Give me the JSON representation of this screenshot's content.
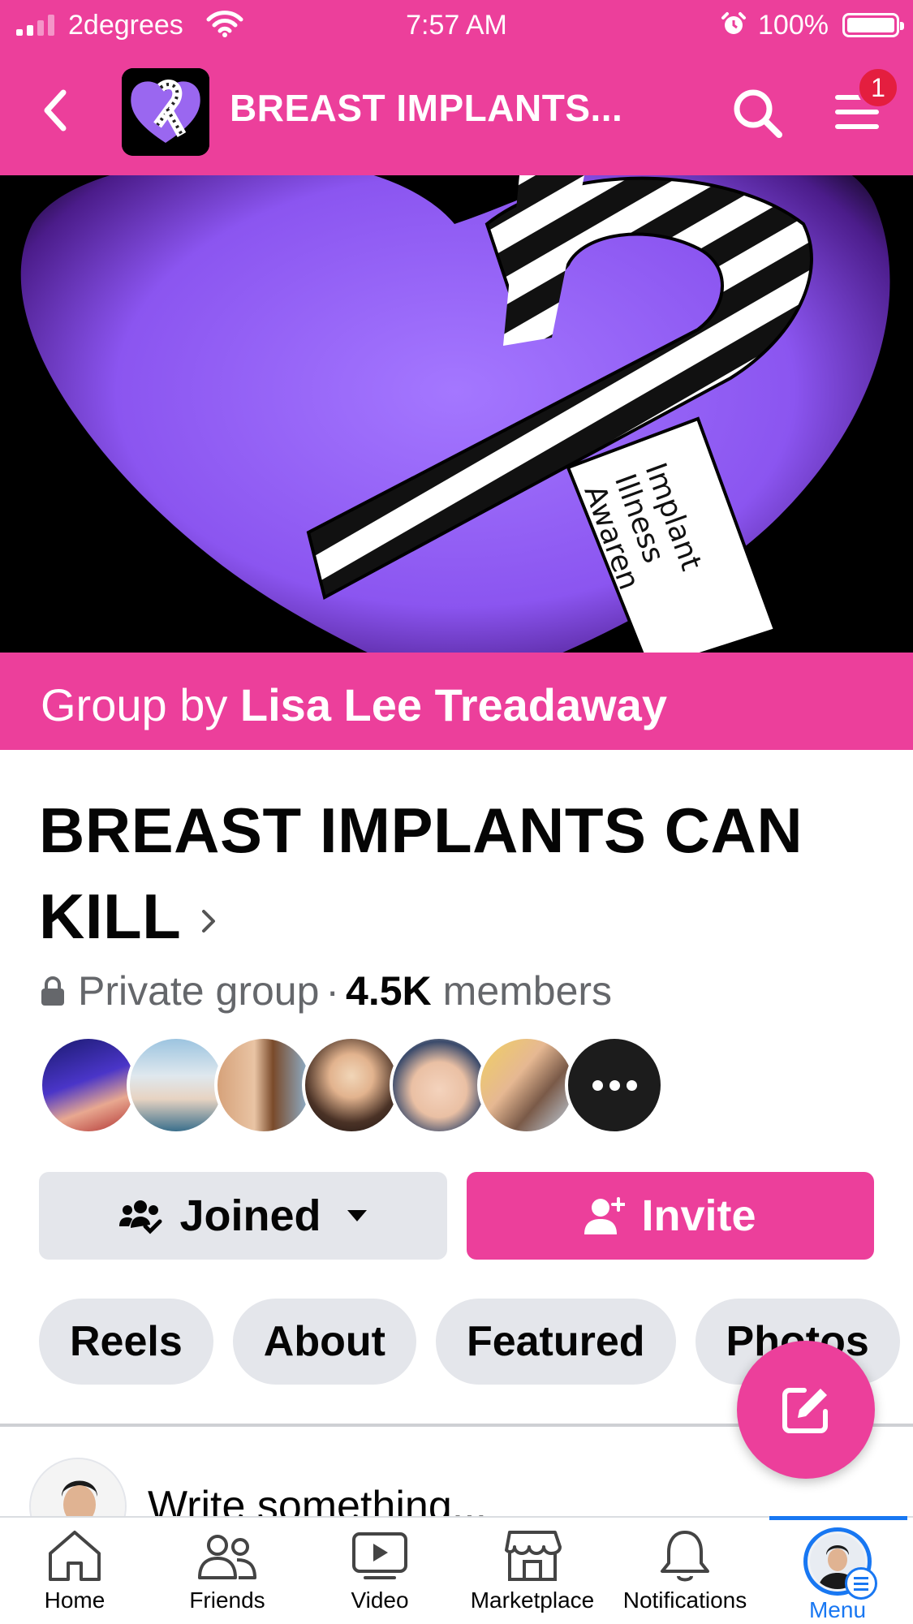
{
  "status_bar": {
    "carrier": "2degrees",
    "time": "7:57 AM",
    "battery": "100%"
  },
  "header": {
    "title": "BREAST IMPLANTS...",
    "notification_badge": "1",
    "accent_color": "#ec3f9b"
  },
  "cover": {
    "ribbon_text": [
      "Implant",
      "Illness",
      "Awaren"
    ]
  },
  "group_by": {
    "prefix": "Group by",
    "owner": "Lisa Lee Treadaway"
  },
  "group": {
    "name": "BREAST IMPLANTS CAN KILL",
    "privacy": "Private group",
    "separator": "·",
    "member_count": "4.5K",
    "members_label": "members"
  },
  "actions": {
    "joined_label": "Joined",
    "invite_label": "Invite"
  },
  "tabs": [
    {
      "label": "Reels"
    },
    {
      "label": "About"
    },
    {
      "label": "Featured"
    },
    {
      "label": "Photos"
    }
  ],
  "composer": {
    "placeholder": "Write something..."
  },
  "bottom_nav": [
    {
      "label": "Home",
      "icon": "home-icon"
    },
    {
      "label": "Friends",
      "icon": "friends-icon"
    },
    {
      "label": "Video",
      "icon": "video-icon"
    },
    {
      "label": "Marketplace",
      "icon": "marketplace-icon"
    },
    {
      "label": "Notifications",
      "icon": "bell-icon"
    },
    {
      "label": "Menu",
      "icon": "menu-avatar-icon"
    }
  ]
}
